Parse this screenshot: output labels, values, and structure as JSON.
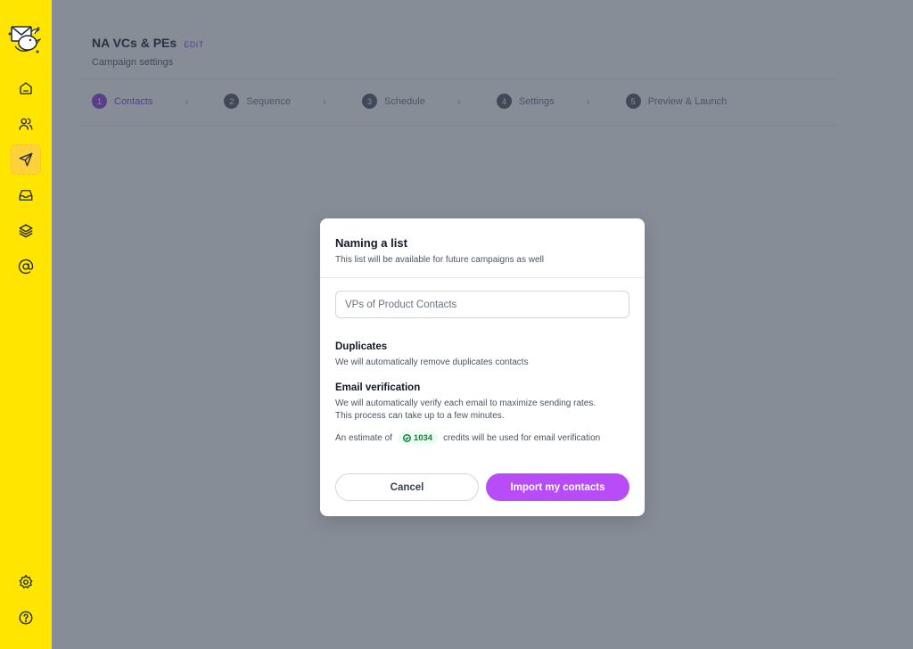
{
  "sidebar": {
    "logo": "mail-bird-logo",
    "items": [
      {
        "name": "home",
        "icon": "home-icon",
        "active": false
      },
      {
        "name": "contacts",
        "icon": "users-icon",
        "active": false
      },
      {
        "name": "campaigns",
        "icon": "send-icon",
        "active": true
      },
      {
        "name": "inbox",
        "icon": "inbox-icon",
        "active": false
      },
      {
        "name": "templates",
        "icon": "layers-icon",
        "active": false
      },
      {
        "name": "email-accounts",
        "icon": "at-sign-icon",
        "active": false
      }
    ],
    "bottom_items": [
      {
        "name": "settings",
        "icon": "gear-icon"
      },
      {
        "name": "help",
        "icon": "help-circle-icon"
      }
    ]
  },
  "header": {
    "title": "NA VCs & PEs",
    "edit_label": "EDIT",
    "subtitle": "Campaign settings"
  },
  "stepper": {
    "steps": [
      {
        "num": "1",
        "label": "Contacts",
        "active": true
      },
      {
        "num": "2",
        "label": "Sequence",
        "active": false
      },
      {
        "num": "3",
        "label": "Schedule",
        "active": false
      },
      {
        "num": "4",
        "label": "Settings",
        "active": false
      },
      {
        "num": "5",
        "label": "Preview & Launch",
        "active": false
      }
    ]
  },
  "modal": {
    "title": "Naming a list",
    "subtitle": "This list will be available for future campaigns as well",
    "input_value": "",
    "input_placeholder": "VPs of Product Contacts",
    "duplicates_title": "Duplicates",
    "duplicates_text": "We will automatically remove duplicates contacts",
    "verification_title": "Email verification",
    "verification_text_1": "We will automatically verify each email to maximize sending rates.",
    "verification_text_2": "This process can take up to a few minutes.",
    "estimate_prefix": "An estimate of",
    "credits": "1034",
    "estimate_suffix": "credits will be used for email verification",
    "cancel_label": "Cancel",
    "import_label": "Import my contacts"
  },
  "colors": {
    "sidebar": "#ffe500",
    "accent": "#b94cf9",
    "step_active": "#7c3aed",
    "credits_green": "#15803d"
  }
}
